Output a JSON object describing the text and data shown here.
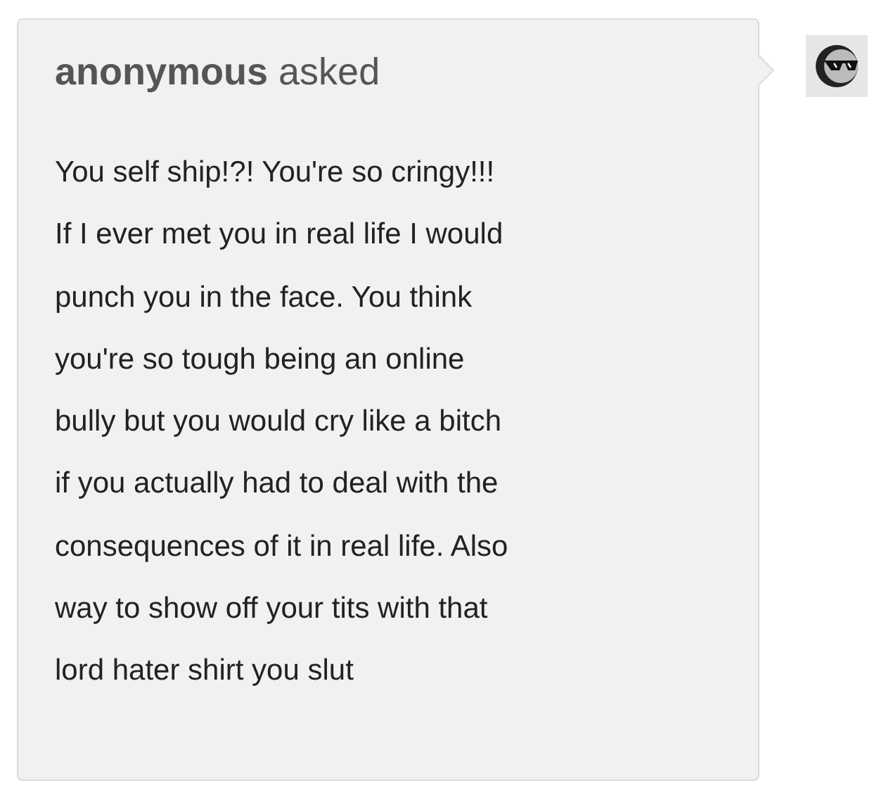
{
  "ask": {
    "header": "**anonymous** asked",
    "question": "You self ship!?! You're so cringy!!!\nIf I ever met you in real life I would\npunch you in the face. You think\nyou're so tough being an online\nbully but you would cry like a bitch\nif you actually had to deal with the\nconsequences of it in real life. Also\nway to show off your tits with that\nlord hater shirt you slut"
  }
}
